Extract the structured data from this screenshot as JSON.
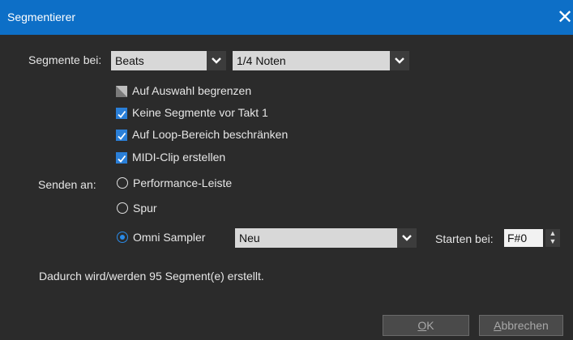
{
  "window": {
    "title": "Segmentierer",
    "close_icon": "close-icon"
  },
  "segments": {
    "label": "Segmente bei:",
    "mode_value": "Beats",
    "resolution_value": "1/4 Noten"
  },
  "options": [
    {
      "label": "Auf Auswahl begrenzen",
      "state": "indeterminate"
    },
    {
      "label": "Keine Segmente vor Takt 1",
      "state": "checked"
    },
    {
      "label": "Auf Loop-Bereich beschränken",
      "state": "checked"
    },
    {
      "label": "MIDI-Clip erstellen",
      "state": "checked"
    }
  ],
  "send": {
    "label": "Senden an:",
    "targets": [
      {
        "label": "Performance-Leiste",
        "selected": false
      },
      {
        "label": "Spur",
        "selected": false
      },
      {
        "label": "Omni Sampler",
        "selected": true
      }
    ],
    "sampler_value": "Neu",
    "start_label": "Starten bei:",
    "start_value": "F#0"
  },
  "info_text": "Dadurch wird/werden 95 Segment(e) erstellt.",
  "buttons": {
    "ok_mnemonic": "O",
    "ok_rest": "K",
    "cancel_mnemonic": "A",
    "cancel_rest": "bbrechen"
  },
  "colors": {
    "titlebar": "#0d6fc7",
    "accent": "#2a7fd8",
    "background": "#2b2b2b"
  }
}
